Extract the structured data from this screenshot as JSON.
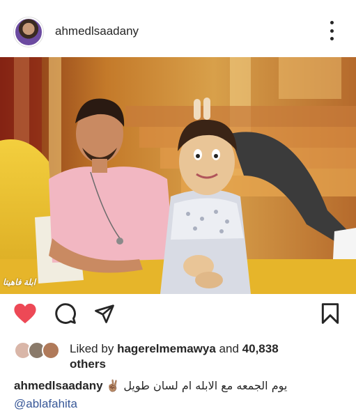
{
  "post": {
    "username": "ahmedlsaadany",
    "image_watermark": "ابلة فاهيتا"
  },
  "likes": {
    "prefix": "Liked by",
    "user": "hagerelmemawya",
    "middle": "and",
    "count": "40,838",
    "suffix": "others"
  },
  "caption": {
    "username": "ahmedlsaadany",
    "text": "✌🏽 يوم الجمعه مع الابله ام لسان طويل",
    "mention": "@ablafahita"
  },
  "colors": {
    "heart": "#ed4956",
    "link": "#385898",
    "text": "#262626"
  },
  "icons": [
    "heart-icon",
    "comment-icon",
    "share-icon",
    "bookmark-icon",
    "more-options-icon"
  ]
}
